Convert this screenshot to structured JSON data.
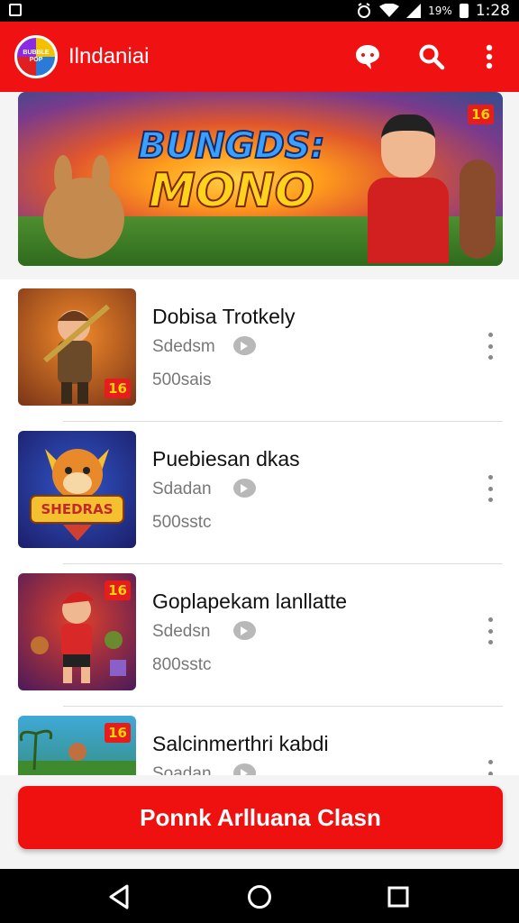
{
  "status_bar": {
    "battery_text": "19%",
    "time": "1:28",
    "icons": [
      "notification-icon",
      "alarm-icon",
      "wifi-icon",
      "signal-icon",
      "battery-icon"
    ]
  },
  "app_bar": {
    "logo_text": "BUBBLE POP",
    "title": "Ilndaniai",
    "icons": [
      "chat-icon",
      "search-icon",
      "more-vert-icon"
    ]
  },
  "banner": {
    "title_line1": "BUNGDS:",
    "title_line2": "MONO",
    "age_rating": "16"
  },
  "games": [
    {
      "title": "Dobisa Trotkely",
      "developer": "Sdedsm",
      "count": "500sais",
      "age_rating": "16",
      "thumb_colors": [
        "#f28a2a",
        "#7a3418"
      ]
    },
    {
      "title": "Puebiesan dkas",
      "developer": "Sdadan",
      "count": "500sstc",
      "age_rating": "",
      "thumb_text": "SHEDRAS",
      "thumb_colors": [
        "#3156c8",
        "#1c1e6a"
      ]
    },
    {
      "title": "Goplapekam lanllatte",
      "developer": "Sdedsn",
      "count": "800sstc",
      "age_rating": "16",
      "thumb_colors": [
        "#e2402a",
        "#4a1a5a"
      ]
    },
    {
      "title": "Salcinmerthri kabdi",
      "developer": "Soadan",
      "count": "",
      "age_rating": "16",
      "thumb_colors": [
        "#3fa9d8",
        "#2e7a3a"
      ]
    }
  ],
  "cta": {
    "label": "Ponnk Arlluana Clasn"
  },
  "colors": {
    "accent": "#f01212",
    "badge_text": "#ffd400"
  },
  "nav_bar": {
    "icons": [
      "back-icon",
      "home-icon",
      "recents-icon"
    ]
  }
}
